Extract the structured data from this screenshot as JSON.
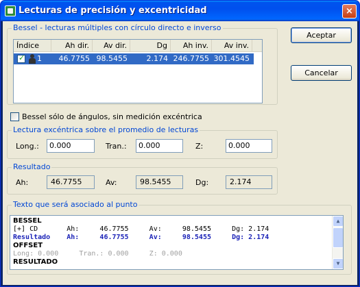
{
  "window": {
    "title": "Lecturas de precisión y excentricidad",
    "close_label": "×"
  },
  "buttons": {
    "accept": "Aceptar",
    "cancel": "Cancelar"
  },
  "bessel_group": {
    "label": "Bessel - lecturas múltiples con círculo directo e inverso",
    "columns": [
      "Índice",
      "Ah dir.",
      "Av dir.",
      "Dg",
      "Ah inv.",
      "Av inv."
    ],
    "rows": [
      {
        "index": "1",
        "ah_dir": "46.7755",
        "av_dir": "98.5455",
        "dg": "2.174",
        "ah_inv": "246.7755",
        "av_inv": "301.4545",
        "checked": true
      }
    ]
  },
  "angles_only": {
    "label": "Bessel sólo de ángulos, sin medición excéntrica",
    "checked": false
  },
  "eccentric_group": {
    "label": "Lectura excéntrica sobre el promedio de lecturas",
    "long_label": "Long.:",
    "long_value": "0.000",
    "tran_label": "Tran.:",
    "tran_value": "0.000",
    "z_label": "Z:",
    "z_value": "0.000"
  },
  "result_group": {
    "label": "Resultado",
    "ah_label": "Ah:",
    "ah_value": "46.7755",
    "av_label": "Av:",
    "av_value": "98.5455",
    "dg_label": "Dg:",
    "dg_value": "2.174"
  },
  "text_group": {
    "label": "Texto que será asociado al punto",
    "lines": [
      "BESSEL",
      "[+] CD       Ah:     46.7755     Av:     98.5455     Dg: 2.174",
      "Resultado    Ah:     46.7755     Av:     98.5455     Dg: 2.174",
      "OFFSET",
      "Long: 0.000     Tran.: 0.000     Z: 0.000",
      "RESULTADO"
    ]
  },
  "colors": {
    "group_label": "#0046d5",
    "selection": "#316ac5",
    "result_text": "#1c24b8"
  }
}
